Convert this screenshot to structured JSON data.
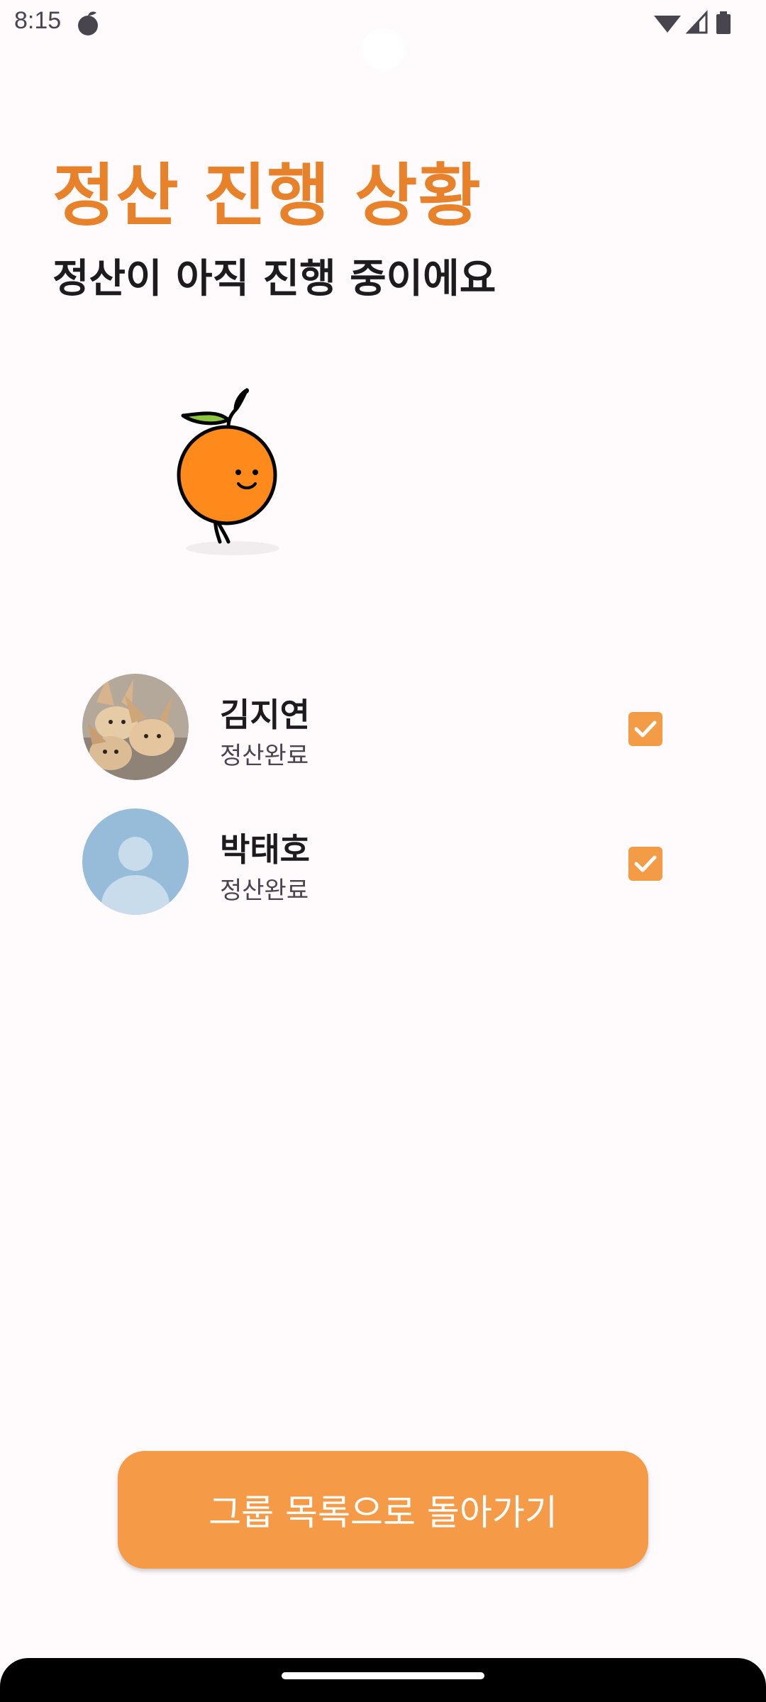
{
  "status_bar": {
    "time": "8:15",
    "app_icon": "mandarin-icon",
    "right_icons": [
      "wifi-icon",
      "cellular-signal-icon",
      "battery-icon"
    ]
  },
  "header": {
    "title": "정산 진행 상황",
    "subtitle": "정산이 아직 진행 중이에요"
  },
  "mascot": {
    "icon": "walking-orange-mascot"
  },
  "participants": [
    {
      "name": "김지연",
      "status": "정산완료",
      "avatar": "fennec-fox-photo",
      "checked": true
    },
    {
      "name": "박태호",
      "status": "정산완료",
      "avatar": "default-person-avatar",
      "checked": true
    }
  ],
  "footer": {
    "back_button_label": "그룹 목록으로 돌아가기"
  },
  "colors": {
    "accent": "#e8822a",
    "button": "#f59b48",
    "checkbox": "#f39b45",
    "background": "#fffbfd"
  }
}
